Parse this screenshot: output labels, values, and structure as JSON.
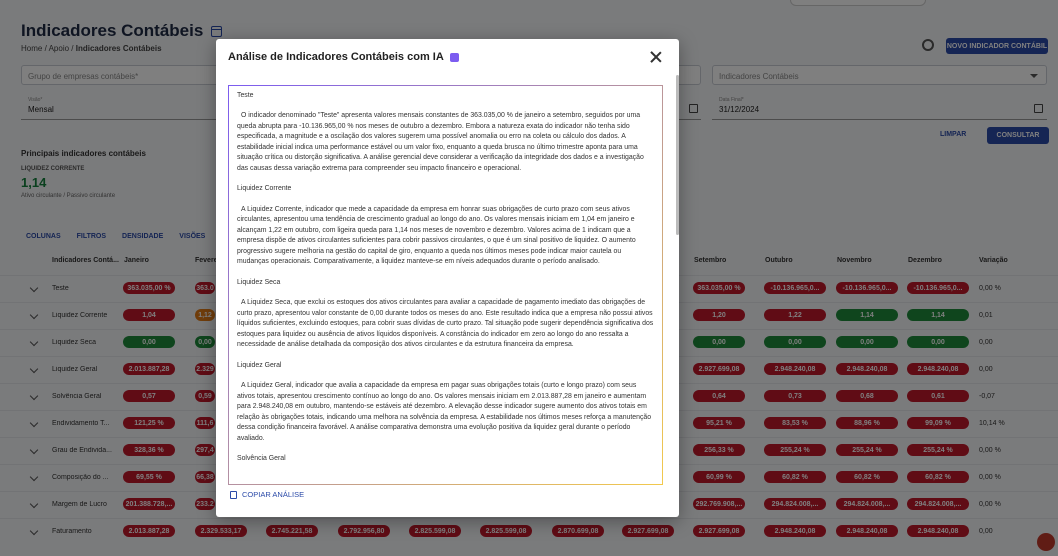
{
  "page": {
    "title": "Indicadores Contábeis",
    "breadcrumb": [
      "Home",
      "Apoio",
      "Indicadores Contábeis"
    ],
    "new_button": "NOVO INDICADOR CONTÁBIL"
  },
  "filters": {
    "group_placeholder": "Grupo de empresas contábeis*",
    "indicators_placeholder": "Indicadores Contábeis",
    "view_label": "Visão*",
    "view_value": "Mensal",
    "end_date_label": "Data Final*",
    "end_date_value": "31/12/2024",
    "clear": "LIMPAR",
    "search": "CONSULTAR"
  },
  "summary": {
    "heading": "Principais indicadores contábeis",
    "card_label": "LIQUIDEZ CORRENTE",
    "card_value": "1,14",
    "card_sub": "Ativo circulante / Passivo circulante"
  },
  "toolbar": {
    "columns": "COLUNAS",
    "filters": "FILTROS",
    "density": "DENSIDADE",
    "views": "VISÕES"
  },
  "table": {
    "headers": {
      "name": "Indicadores Contá...",
      "jan": "Janeiro",
      "feb": "Fevere",
      "sep": "Setembro",
      "oct": "Outubro",
      "nov": "Novembro",
      "dec": "Dezembro",
      "var": "Variação"
    },
    "rows": [
      {
        "name": "Teste",
        "jan": "363.035,00 %",
        "feb": "363.0",
        "sep": "363.035,00 %",
        "oct": "-10.136.965,0...",
        "nov": "-10.136.965,0...",
        "dec": "-10.136.965,0...",
        "var": "0,00 %"
      },
      {
        "name": "Liquidez Corrente",
        "jan": "1,04",
        "feb": "1,12",
        "sep": "1,20",
        "oct": "1,22",
        "nov": "1,14",
        "dec": "1,14",
        "var": "0,01"
      },
      {
        "name": "Liquidez Seca",
        "jan": "0,00",
        "feb": "0,00",
        "sep": "0,00",
        "oct": "0,00",
        "nov": "0,00",
        "dec": "0,00",
        "var": "0,00"
      },
      {
        "name": "Liquidez Geral",
        "jan": "2.013.887,28",
        "feb": "2.329",
        "sep": "2.927.699,08",
        "oct": "2.948.240,08",
        "nov": "2.948.240,08",
        "dec": "2.948.240,08",
        "var": "0,00"
      },
      {
        "name": "Solvência Geral",
        "jan": "0,57",
        "feb": "0,59",
        "sep": "0,64",
        "oct": "0,73",
        "nov": "0,68",
        "dec": "0,61",
        "var": "-0,07"
      },
      {
        "name": "Endividamento T...",
        "jan": "121,25 %",
        "feb": "111,6",
        "sep": "95,21 %",
        "oct": "83,53 %",
        "nov": "88,96 %",
        "dec": "99,09 %",
        "var": "10,14 %"
      },
      {
        "name": "Grau de Endivida...",
        "jan": "328,36 %",
        "feb": "297,4",
        "sep": "256,33 %",
        "oct": "255,24 %",
        "nov": "255,24 %",
        "dec": "255,24 %",
        "var": "0,00 %"
      },
      {
        "name": "Composição do ...",
        "jan": "69,55 %",
        "feb": "66,38",
        "sep": "60,99 %",
        "oct": "60,82 %",
        "nov": "60,82 %",
        "dec": "60,82 %",
        "var": "0,00 %"
      },
      {
        "name": "Margem de Lucro",
        "jan": "201.388.728,...",
        "feb": "233.2",
        "sep": "292.769.908,...",
        "oct": "294.824.008,...",
        "nov": "294.824.008,...",
        "dec": "294.824.008,...",
        "var": "0,00 %"
      },
      {
        "name": "Faturamento",
        "jan": "2.013.887,28",
        "feb": "2.329.533,17",
        "sep": "2.927.699,08",
        "oct": "2.948.240,08",
        "nov": "2.948.240,08",
        "dec": "2.948.240,08",
        "var": "0,00"
      }
    ],
    "faturamento_extra": [
      "2.745.221,58",
      "2.792.956,80",
      "2.825.599,08",
      "2.825.599,08",
      "2.870.699,08",
      "2.927.699,08"
    ]
  },
  "colors": {
    "red": "#c0182a",
    "green": "#1e8a3a",
    "orange": "#e07b17",
    "primary": "#2b4aa8"
  },
  "modal": {
    "title": "Análise de Indicadores Contábeis com IA",
    "paragraphs": [
      "Teste",
      "O indicador denominado \"Teste\" apresenta valores mensais constantes de 363.035,00 % de janeiro a setembro, seguidos por uma queda abrupta para -10.136.965,00 % nos meses de outubro a dezembro. Embora a natureza exata do indicador não tenha sido especificada, a magnitude e a oscilação dos valores sugerem uma possível anomalia ou erro na coleta ou cálculo dos dados. A estabilidade inicial indica uma performance estável ou um valor fixo, enquanto a queda brusca no último trimestre aponta para uma situação crítica ou distorção significativa. A análise gerencial deve considerar a verificação da integridade dos dados e a investigação das causas dessa variação extrema para compreender seu impacto financeiro e operacional.",
      "Liquidez Corrente",
      "A Liquidez Corrente, indicador que mede a capacidade da empresa em honrar suas obrigações de curto prazo com seus ativos circulantes, apresentou uma tendência de crescimento gradual ao longo do ano. Os valores mensais iniciam em 1,04 em janeiro e alcançam 1,22 em outubro, com ligeira queda para 1,14 nos meses de novembro e dezembro. Valores acima de 1 indicam que a empresa dispõe de ativos circulantes suficientes para cobrir passivos circulantes, o que é um sinal positivo de liquidez. O aumento progressivo sugere melhoria na gestão do capital de giro, enquanto a queda nos últimos meses pode indicar maior cautela ou mudanças operacionais. Comparativamente, a liquidez manteve-se em níveis adequados durante o período analisado.",
      "Liquidez Seca",
      "A Liquidez Seca, que exclui os estoques dos ativos circulantes para avaliar a capacidade de pagamento imediato das obrigações de curto prazo, apresentou valor constante de 0,00 durante todos os meses do ano. Este resultado indica que a empresa não possui ativos líquidos suficientes, excluindo estoques, para cobrir suas dívidas de curto prazo. Tal situação pode sugerir dependência significativa dos estoques para liquidez ou ausência de ativos líquidos disponíveis. A constância do indicador em zero ao longo do ano ressalta a necessidade de análise detalhada da composição dos ativos circulantes e da estrutura financeira da empresa.",
      "Liquidez Geral",
      "A Liquidez Geral, indicador que avalia a capacidade da empresa em pagar suas obrigações totais (curto e longo prazo) com seus ativos totais, apresentou crescimento contínuo ao longo do ano. Os valores mensais iniciam em 2.013.887,28 em janeiro e aumentam para 2.948.240,08 em outubro, mantendo-se estáveis até dezembro. A elevação desse indicador sugere aumento dos ativos totais em relação às obrigações totais, indicando uma melhora na solvência da empresa. A estabilidade nos últimos meses reforça a manutenção dessa condição financeira favorável. A análise comparativa demonstra uma evolução positiva da liquidez geral durante o período avaliado.",
      "Solvência Geral"
    ],
    "copy_label": "COPIAR ANÁLISE"
  }
}
